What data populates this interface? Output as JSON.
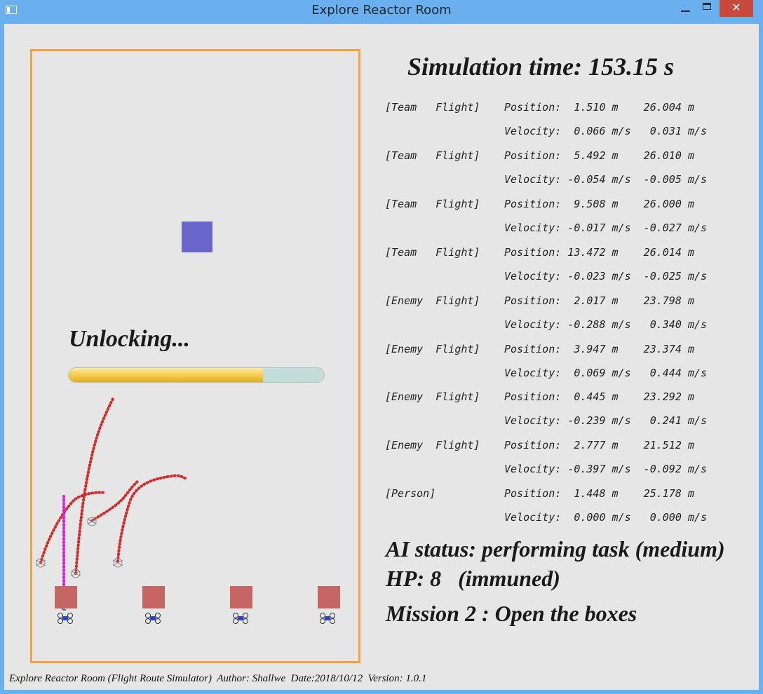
{
  "window": {
    "title": "Explore Reactor Room",
    "minimize": "",
    "maximize": "",
    "close": "✕"
  },
  "header": {
    "sim_time": "Simulation time: 153.15 s"
  },
  "arena": {
    "status_text": "Unlocking...",
    "unlock_progress": 0.76,
    "goal_boxes_count": 4,
    "colors": {
      "border": "#f5a043",
      "target": "#6a67cc",
      "goal_box": "#c66664",
      "path_team": "#d42a2a",
      "path_person": "#d81ed8",
      "progress": "#f6c94a"
    }
  },
  "table": [
    {
      "label": "[Team   Flight]",
      "position": "Position:  1.510 m    26.004 m",
      "velocity": "Velocity:  0.066 m/s   0.031 m/s"
    },
    {
      "label": "[Team   Flight]",
      "position": "Position:  5.492 m    26.010 m",
      "velocity": "Velocity: -0.054 m/s  -0.005 m/s"
    },
    {
      "label": "[Team   Flight]",
      "position": "Position:  9.508 m    26.000 m",
      "velocity": "Velocity: -0.017 m/s  -0.027 m/s"
    },
    {
      "label": "[Team   Flight]",
      "position": "Position: 13.472 m    26.014 m",
      "velocity": "Velocity: -0.023 m/s  -0.025 m/s"
    },
    {
      "label": "[Enemy  Flight]",
      "position": "Position:  2.017 m    23.798 m",
      "velocity": "Velocity: -0.288 m/s   0.340 m/s"
    },
    {
      "label": "[Enemy  Flight]",
      "position": "Position:  3.947 m    23.374 m",
      "velocity": "Velocity:  0.069 m/s   0.444 m/s"
    },
    {
      "label": "[Enemy  Flight]",
      "position": "Position:  0.445 m    23.292 m",
      "velocity": "Velocity: -0.239 m/s   0.241 m/s"
    },
    {
      "label": "[Enemy  Flight]",
      "position": "Position:  2.777 m    21.512 m",
      "velocity": "Velocity: -0.397 m/s  -0.092 m/s"
    },
    {
      "label": "[Person]",
      "position": "Position:  1.448 m    25.178 m",
      "velocity": "Velocity:  0.000 m/s   0.000 m/s"
    }
  ],
  "status": {
    "ai": "AI status: performing task (medium)",
    "hp": "HP: 8   (immuned)",
    "mission": "Mission 2 : Open the boxes"
  },
  "footer": "Explore Reactor Room (Flight Route Simulator)  Author: Shallwe  Date:2018/10/12  Version: 1.0.1"
}
